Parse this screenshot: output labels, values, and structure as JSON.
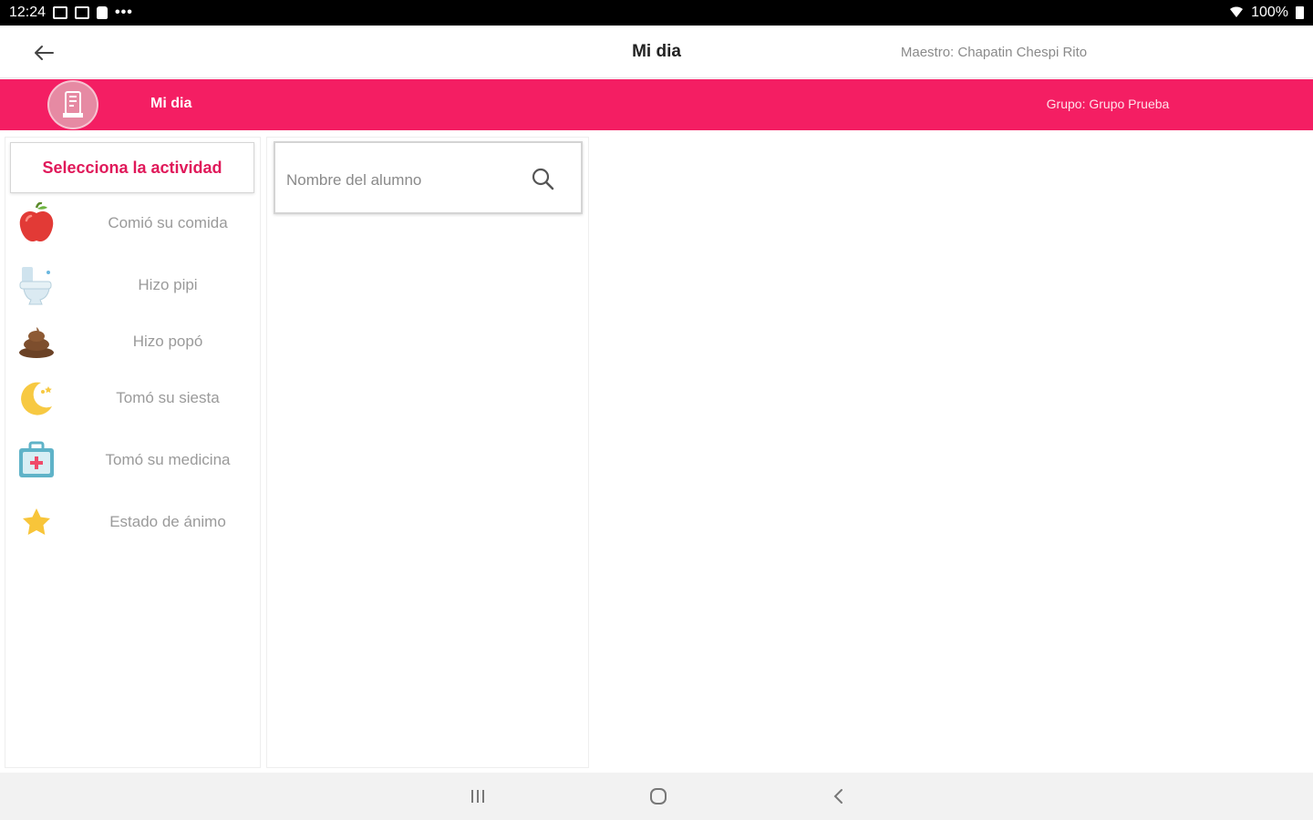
{
  "status_bar": {
    "time": "12:24",
    "overflow_dots": "•••",
    "battery_text": "100%"
  },
  "app_bar": {
    "title": "Mi dia",
    "teacher": "Maestro: Chapatin Chespi Rito"
  },
  "pink_bar": {
    "title": "Mi dia",
    "group": "Grupo: Grupo Prueba",
    "color": "#f41e63"
  },
  "activities": {
    "header": "Selecciona la actividad",
    "items": [
      {
        "label": "Comió su comida",
        "icon": "apple-icon"
      },
      {
        "label": "Hizo pipi",
        "icon": "toilet-icon"
      },
      {
        "label": "Hizo popó",
        "icon": "poop-icon"
      },
      {
        "label": "Tomó su siesta",
        "icon": "moon-icon"
      },
      {
        "label": "Tomó su medicina",
        "icon": "first-aid-kit-icon"
      },
      {
        "label": "Estado de ánimo",
        "icon": "star-icon"
      }
    ]
  },
  "search": {
    "placeholder": "Nombre del alumno",
    "value": ""
  },
  "colors": {
    "accent": "#f41e63",
    "header_text": "#e0195a"
  }
}
